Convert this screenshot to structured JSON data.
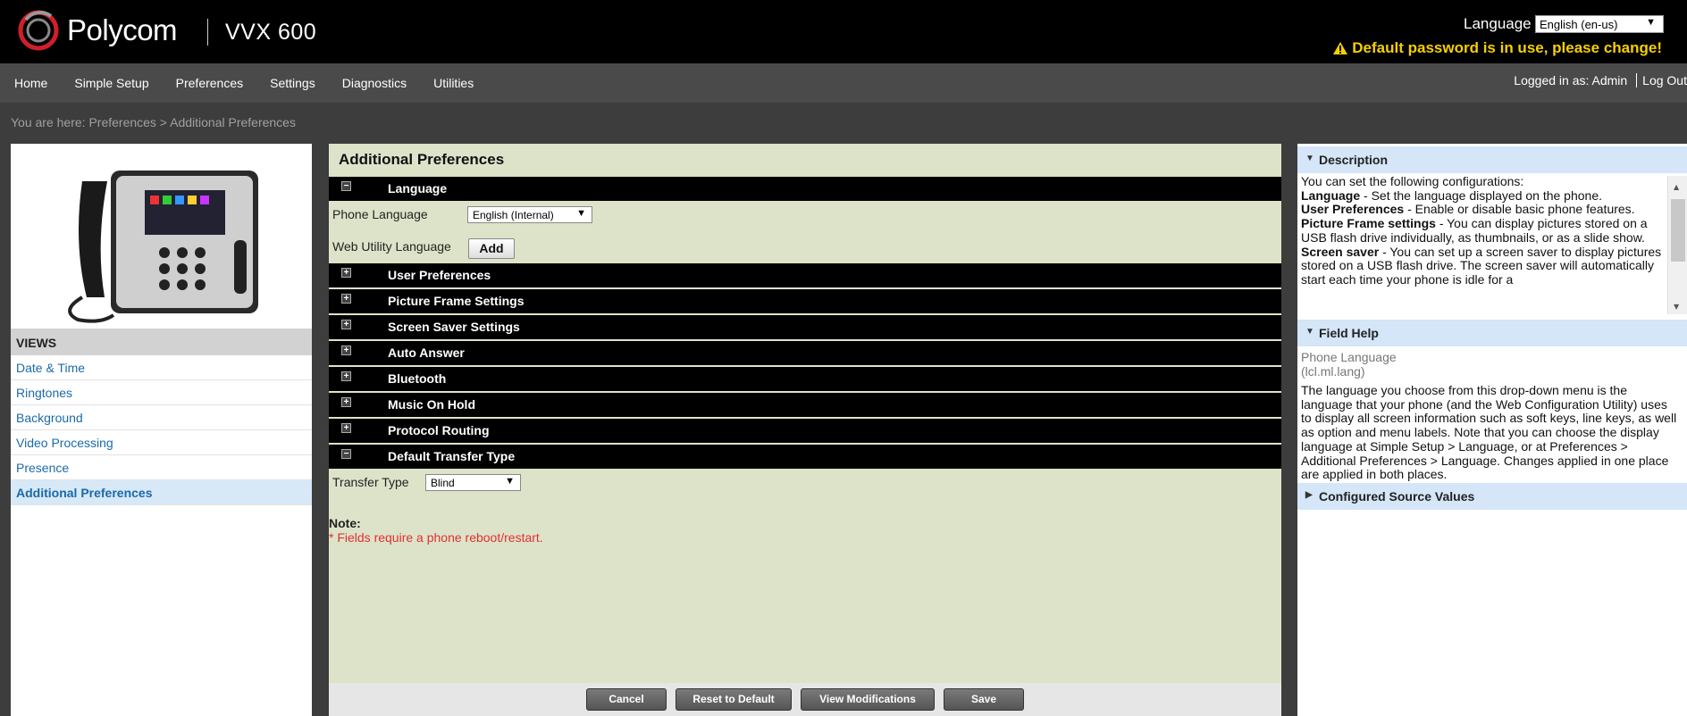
{
  "header": {
    "brand": "Polycom",
    "model": "VVX 600",
    "language_label": "Language",
    "language_value": "English (en-us)",
    "warning": "Default password is in use, please change!"
  },
  "nav": {
    "items": [
      "Home",
      "Simple Setup",
      "Preferences",
      "Settings",
      "Diagnostics",
      "Utilities"
    ],
    "logged_in": "Logged in as: Admin",
    "logout": "Log Out"
  },
  "breadcrumb": "You are here: Preferences > Additional Preferences",
  "sidebar": {
    "views_heading": "VIEWS",
    "items": [
      "Date & Time",
      "Ringtones",
      "Background",
      "Video Processing",
      "Presence",
      "Additional Preferences"
    ],
    "active": "Additional Preferences"
  },
  "main": {
    "title": "Additional Preferences",
    "sections": [
      {
        "label": "Language",
        "expanded": true
      },
      {
        "label": "User Preferences",
        "expanded": false
      },
      {
        "label": "Picture Frame Settings",
        "expanded": false
      },
      {
        "label": "Screen Saver Settings",
        "expanded": false
      },
      {
        "label": "Auto Answer",
        "expanded": false
      },
      {
        "label": "Bluetooth",
        "expanded": false
      },
      {
        "label": "Music On Hold",
        "expanded": false
      },
      {
        "label": "Protocol Routing",
        "expanded": false
      },
      {
        "label": "Default Transfer Type",
        "expanded": true
      }
    ],
    "phone_language_label": "Phone Language",
    "phone_language_value": "English (Internal)",
    "web_utility_label": "Web Utility Language",
    "add_label": "Add",
    "transfer_type_label": "Transfer Type",
    "transfer_type_value": "Blind",
    "note_heading": "Note:",
    "note_text": "* Fields require a phone reboot/restart."
  },
  "buttons": {
    "cancel": "Cancel",
    "reset": "Reset to Default",
    "view_mods": "View Modifications",
    "save": "Save"
  },
  "right": {
    "description_heading": "Description",
    "description_intro": "You can set the following configurations:",
    "desc_items": [
      {
        "term": "Language",
        "text": " - Set the language displayed on the phone."
      },
      {
        "term": "User Preferences",
        "text": " - Enable or disable basic phone features."
      },
      {
        "term": "Picture Frame settings",
        "text": " - You can display pictures stored on a USB flash drive individually, as thumbnails, or as a slide show."
      },
      {
        "term": "Screen saver",
        "text": " - You can set up a screen saver to display pictures stored on a USB flash drive. The screen saver will automatically start each time your phone is idle for a"
      }
    ],
    "field_help_heading": "Field Help",
    "field_name": "Phone Language",
    "field_param": "(lcl.ml.lang)",
    "field_help_text": "The language you choose from this drop-down menu is the language that your phone (and the Web Configuration Utility) uses to display all screen information such as soft keys, line keys, as well as option and menu labels. Note that you can choose the display language at Simple Setup > Language, or at Preferences > Additional Preferences > Language. Changes applied in one place are applied in both places.",
    "configured_heading": "Configured Source Values"
  },
  "colors": {
    "accent_blue": "#1b6aa8",
    "warning_yellow": "#f5d000",
    "main_bg": "#dde3c9",
    "note_red": "#e03030"
  }
}
